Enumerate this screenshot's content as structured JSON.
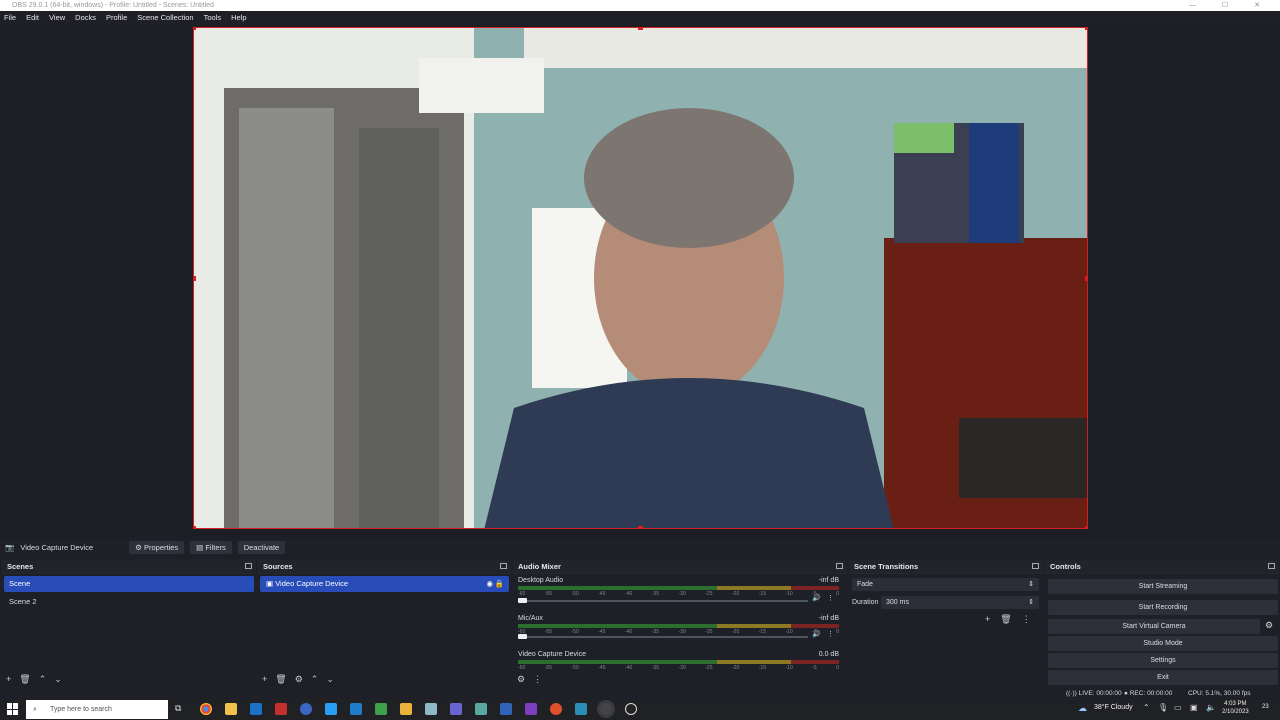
{
  "window": {
    "title": "OBS 29.0.1 (64-bit, windows) - Profile: Untitled - Scenes: Untitled"
  },
  "menu": [
    "File",
    "Edit",
    "View",
    "Docks",
    "Profile",
    "Scene Collection",
    "Tools",
    "Help"
  ],
  "source_toolbar": {
    "source_name": "Video Capture Device",
    "properties": "Properties",
    "filters": "Filters",
    "deactivate": "Deactivate"
  },
  "scenes": {
    "title": "Scenes",
    "items": [
      "Scene",
      "Scene 2"
    ]
  },
  "sources": {
    "title": "Sources",
    "items": [
      "Video Capture Device"
    ]
  },
  "audio_mixer": {
    "title": "Audio Mixer",
    "channels": [
      {
        "name": "Desktop Audio",
        "level": "-inf dB"
      },
      {
        "name": "Mic/Aux",
        "level": "-inf dB"
      },
      {
        "name": "Video Capture Device",
        "level": "0.0 dB"
      }
    ],
    "scale": [
      "-60",
      "-55",
      "-50",
      "-45",
      "-40",
      "-35",
      "-30",
      "-25",
      "-20",
      "-15",
      "-10",
      "-5",
      "0"
    ]
  },
  "scene_transitions": {
    "title": "Scene Transitions",
    "transition": "Fade",
    "duration_label": "Duration",
    "duration_value": "300 ms"
  },
  "controls": {
    "title": "Controls",
    "start_streaming": "Start Streaming",
    "start_recording": "Start Recording",
    "start_virtual_camera": "Start Virtual Camera",
    "studio_mode": "Studio Mode",
    "settings": "Settings",
    "exit": "Exit"
  },
  "status": {
    "live": "LIVE: 00:00:00",
    "rec": "REC: 00:00:00",
    "cpu": "CPU: 5.1%, 30.00 fps"
  },
  "taskbar": {
    "search_placeholder": "Type here to search",
    "weather": "38°F  Cloudy",
    "time": "4:03 PM",
    "date": "2/10/2023",
    "notifications": "23"
  },
  "colors": {
    "accent": "#284cb8",
    "selection_border": "#d21f1f",
    "bg": "#1f2027"
  }
}
